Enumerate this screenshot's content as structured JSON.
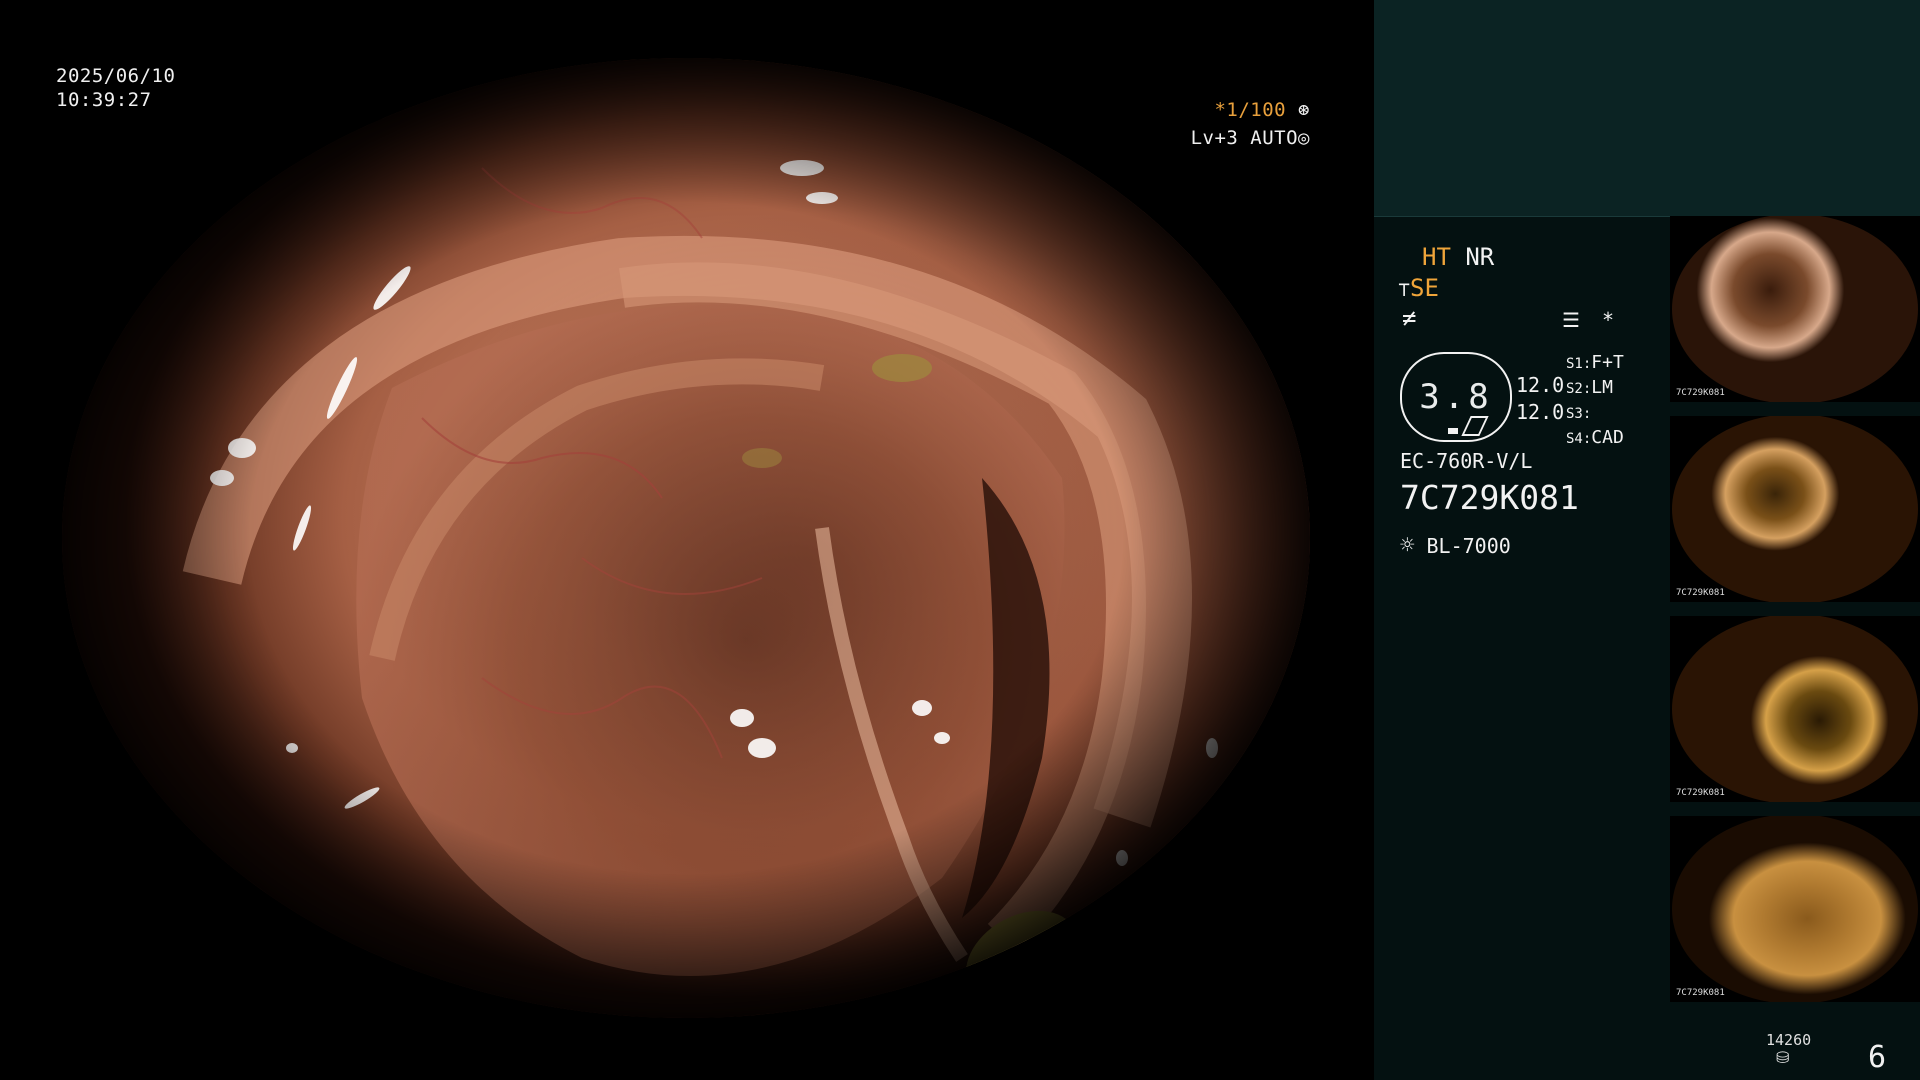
{
  "overlay": {
    "date": "2025/06/10",
    "time": "10:39:27",
    "shutter_prefix": "*",
    "shutter_value": "1/100",
    "shutter_icon": "aperture-icon",
    "level": "Lv+3",
    "mode": "AUTO",
    "mode_icon": "auto-exposure-icon"
  },
  "panel": {
    "ht": "HT",
    "nr": "NR",
    "se": "SE",
    "se_icon": "structure-enhance-icon",
    "f_icon": "filter-icon",
    "menu_icon": "settings-icon",
    "star": "*",
    "gauge_value": "3.8",
    "gauge_line1": "12.0",
    "gauge_line2": "12.0",
    "s1_label": "S1:",
    "s1_value": "F+T",
    "s2_label": "S2:",
    "s2_value": "LM",
    "s3_label": "S3:",
    "s3_value": "",
    "s4_label": "S4:",
    "s4_value": "CAD",
    "scope_model": "EC-760R-V/L",
    "serial": "7C729K081",
    "light_icon": "light-source-icon",
    "light_source": "BL-7000",
    "counter": "14260",
    "counter_icon": "storage-icon",
    "page_number": "6"
  },
  "thumbnails": [
    {
      "label": "7C729K081",
      "tint": "#b98a70"
    },
    {
      "label": "7C729K081",
      "tint": "#b07a38"
    },
    {
      "label": "7C729K081",
      "tint": "#a8752a"
    },
    {
      "label": "7C729K081",
      "tint": "#9c6a22"
    }
  ],
  "colors": {
    "accent_orange": "#f0a53a",
    "panel_top": "#0b2323",
    "panel_bottom": "#041111"
  }
}
